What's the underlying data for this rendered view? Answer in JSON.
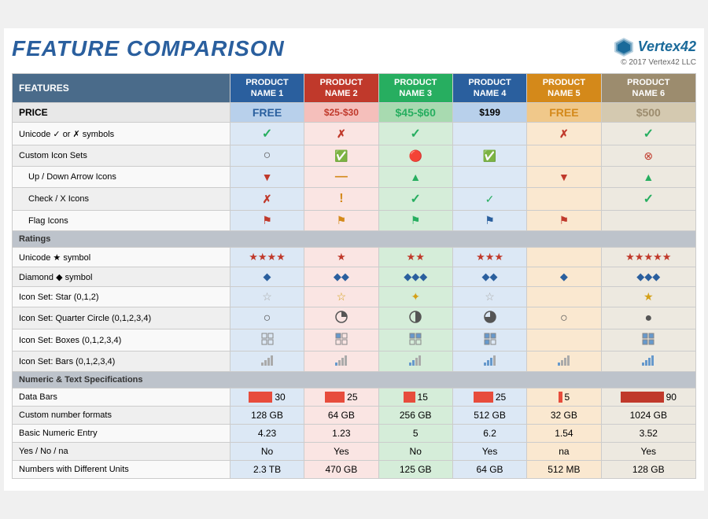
{
  "title": "FEATURE COMPARISON",
  "logo": {
    "name": "Vertex42",
    "copyright": "© 2017 Vertex42 LLC"
  },
  "columns": [
    {
      "id": "features",
      "label": "FEATURES"
    },
    {
      "id": "p1",
      "label": "PRODUCT\nNAME 1",
      "color": "blue"
    },
    {
      "id": "p2",
      "label": "PRODUCT\nNAME 2",
      "color": "red"
    },
    {
      "id": "p3",
      "label": "PRODUCT\nNAME 3",
      "color": "green"
    },
    {
      "id": "p4",
      "label": "PRODUCT\nNAME 4",
      "color": "blue"
    },
    {
      "id": "p5",
      "label": "PRODUCT\nNAME 5",
      "color": "orange"
    },
    {
      "id": "p6",
      "label": "PRODUCT\nNAME 6",
      "color": "taupe"
    }
  ],
  "prices": [
    "FREE",
    "$25-$30",
    "$45-$60",
    "$199",
    "FREE",
    "$500"
  ],
  "sections": {
    "ratings_label": "Ratings",
    "numeric_label": "Numeric & Text Specifications"
  },
  "rows": [
    {
      "feature": "Unicode ✓ or ✗ symbols",
      "p1": "check",
      "p2": "x-red",
      "p3": "check",
      "p4": "",
      "p5": "x-red",
      "p6": "check"
    },
    {
      "feature": "Custom Icon Sets",
      "p1": "circle-empty",
      "p2": "circle-green",
      "p3": "circle-red",
      "p4": "circle-green",
      "p5": "",
      "p6": "circle-red"
    },
    {
      "feature": "Up / Down Arrow Icons",
      "sub": true,
      "p1": "arrow-down-red",
      "p2": "minus-orange",
      "p3": "arrow-up-green",
      "p4": "",
      "p5": "arrow-down-orange",
      "p6": "arrow-up-green"
    },
    {
      "feature": "Check / X Icons",
      "sub": true,
      "p1": "x-orange",
      "p2": "exclaim-orange",
      "p3": "check",
      "p4": "check-teal",
      "p5": "",
      "p6": "check"
    },
    {
      "feature": "Flag Icons",
      "sub": true,
      "p1": "flag-red",
      "p2": "flag-orange",
      "p3": "flag-green",
      "p4": "flag-teal",
      "p5": "flag-red",
      "p6": ""
    }
  ],
  "rating_rows": [
    {
      "feature": "Unicode ★ symbol",
      "p1": "★★★★",
      "p2": "★",
      "p3": "★★",
      "p4": "★★★",
      "p5": "",
      "p6": "★★★★★",
      "type": "star-red"
    },
    {
      "feature": "Diamond ◆ symbol",
      "p1": "◆",
      "p2": "◆◆",
      "p3": "◆◆◆",
      "p4": "◆◆",
      "p5": "◆",
      "p6": "◆◆◆",
      "type": "diamond-blue"
    },
    {
      "feature": "Icon Set: Star (0,1,2)",
      "p1": "star-outline",
      "p2": "star-outline",
      "p3": "star-half",
      "p4": "star-outline",
      "p5": "",
      "p6": "star-gold"
    },
    {
      "feature": "Icon Set: Quarter Circle (0,1,2,3,4)",
      "p1": "circle-empty-lg",
      "p2": "qc-quarter",
      "p3": "qc-half",
      "p4": "qc-threequarter",
      "p5": "circle-empty-lg",
      "p6": "circle-full"
    },
    {
      "feature": "Icon Set: Boxes (0,1,2,3,4)",
      "p1": "box-empty",
      "p2": "box-q1",
      "p3": "box-half",
      "p4": "box-q3",
      "p5": "",
      "p6": "box-full"
    },
    {
      "feature": "Icon Set: Bars (0,1,2,3,4)",
      "p1": "bars-0",
      "p2": "bars-1",
      "p3": "bars-2",
      "p4": "bars-3",
      "p5": "bars-1",
      "p6": "bars-4"
    }
  ],
  "numeric_rows": [
    {
      "feature": "Data Bars",
      "p1": "30",
      "p2": "25",
      "p3": "15",
      "p4": "25",
      "p5": "5",
      "p6": "90",
      "type": "databar"
    },
    {
      "feature": "Custom number formats",
      "p1": "128 GB",
      "p2": "64 GB",
      "p3": "256 GB",
      "p4": "512 GB",
      "p5": "32 GB",
      "p6": "1024 GB"
    },
    {
      "feature": "Basic Numeric Entry",
      "p1": "4.23",
      "p2": "1.23",
      "p3": "5",
      "p4": "6.2",
      "p5": "1.54",
      "p6": "3.52"
    },
    {
      "feature": "Yes / No / na",
      "p1": "No",
      "p2": "Yes",
      "p3": "No",
      "p4": "Yes",
      "p5": "na",
      "p6": "Yes"
    },
    {
      "feature": "Numbers with Different Units",
      "p1": "2.3 TB",
      "p2": "470 GB",
      "p3": "125 GB",
      "p4": "64 GB",
      "p5": "512 MB",
      "p6": "128 GB"
    }
  ]
}
